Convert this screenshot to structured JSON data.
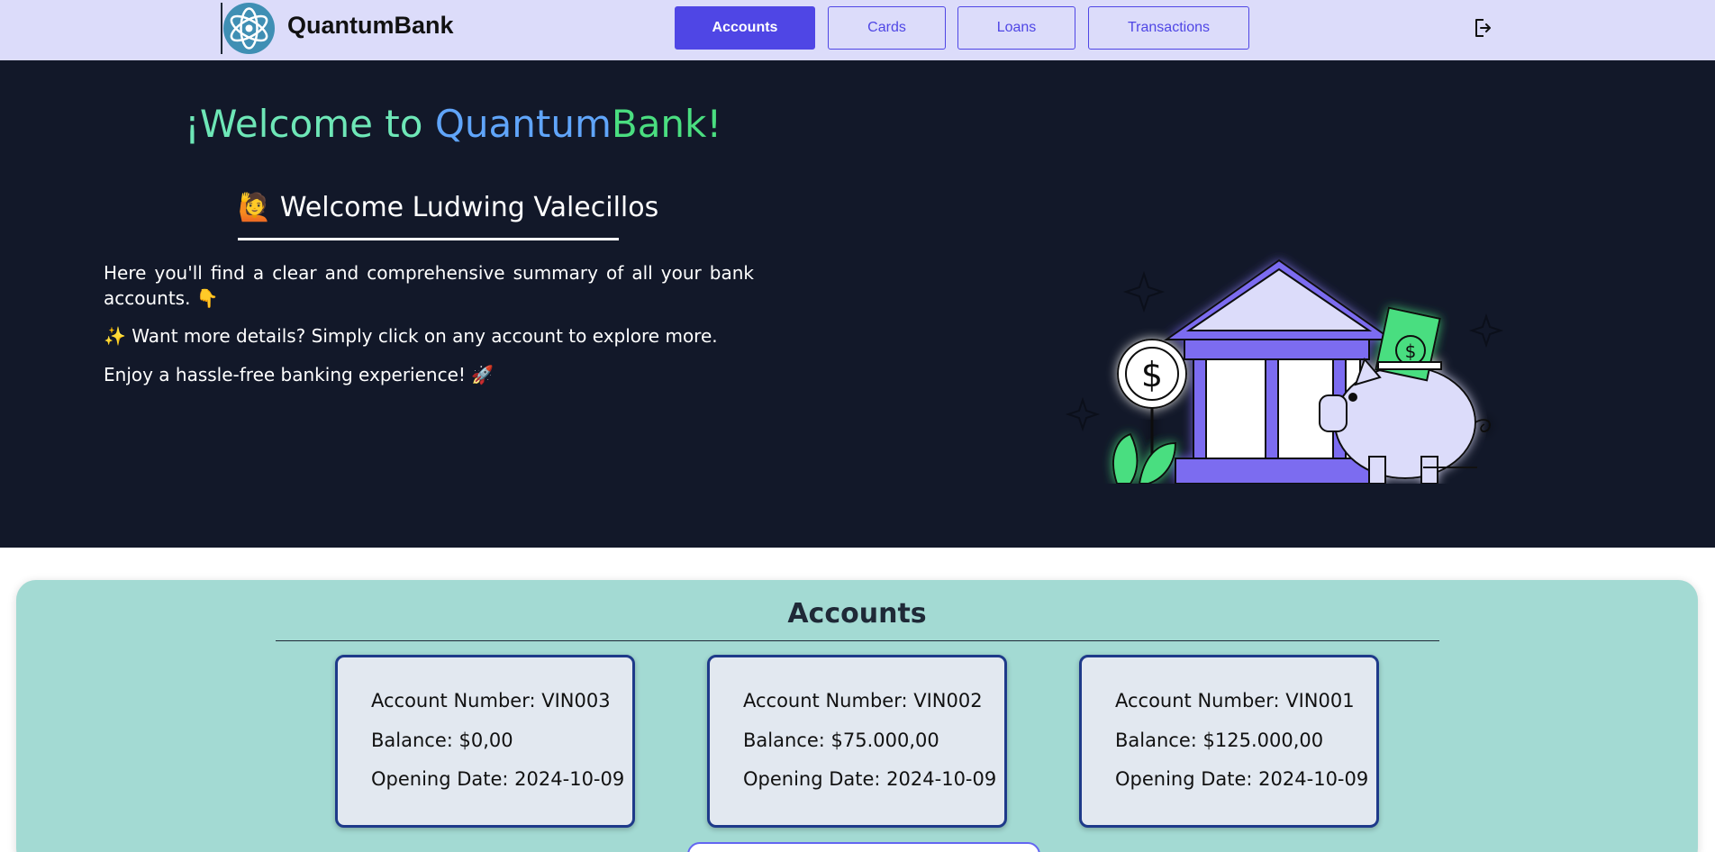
{
  "header": {
    "brand": "QuantumBank",
    "nav": {
      "accounts": "Accounts",
      "cards": "Cards",
      "loans": "Loans",
      "transactions": "Transactions"
    },
    "active_tab": "Accounts",
    "logo_icon": "atom-logo-icon",
    "logout_icon": "logout-icon"
  },
  "hero": {
    "title_part1": "¡Welcome to ",
    "title_part2": "Quantum",
    "title_part3": "Bank!",
    "welcome_emoji": "🙋",
    "welcome_user": "Welcome Ludwing Valecillos",
    "para1": "Here you'll find a clear and comprehensive summary of all your bank accounts. 👇",
    "para2": "✨ Want more details? Simply click on any account to explore more.",
    "para3": "Enjoy a hassle-free banking experience! 🚀",
    "illustration": "bank-piggybank-illustration"
  },
  "accounts": {
    "title": "Accounts",
    "items": [
      {
        "number": "Account Number: VIN003",
        "balance": "Balance: $0,00",
        "opening": "Opening Date: 2024-10-09"
      },
      {
        "number": "Account Number: VIN002",
        "balance": "Balance: $75.000,00",
        "opening": "Opening Date: 2024-10-09"
      },
      {
        "number": "Account Number: VIN001",
        "balance": "Balance: $125.000,00",
        "opening": "Opening Date: 2024-10-09"
      }
    ]
  },
  "colors": {
    "header_bg": "#dcdcfa",
    "accent": "#4f46e5",
    "hero_bg": "#121829",
    "accounts_bg": "#a3dad3",
    "card_border": "#1e3a8a"
  }
}
